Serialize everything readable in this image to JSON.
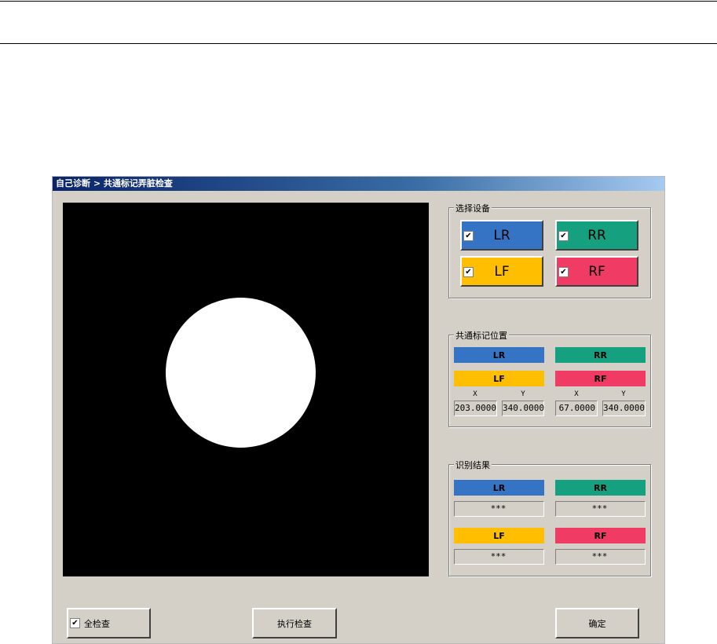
{
  "window": {
    "title": "自己诊断 > 共通标记弄脏检查"
  },
  "colors": {
    "LR": "#3574c4",
    "RR": "#15a080",
    "LF": "#ffbf00",
    "RF": "#f03c64"
  },
  "select_devices": {
    "label": "选择设备",
    "devices": [
      {
        "label": "LR",
        "checked": true
      },
      {
        "label": "RR",
        "checked": true
      },
      {
        "label": "LF",
        "checked": true
      },
      {
        "label": "RF",
        "checked": true
      }
    ]
  },
  "marker_position": {
    "label": "共通标记位置",
    "bars": [
      "LR",
      "RR",
      "LF",
      "RF"
    ],
    "x_label": "X",
    "y_label": "Y",
    "left": {
      "x": "203.0000",
      "y": "340.0000"
    },
    "right": {
      "x": "67.0000",
      "y": "340.0000"
    }
  },
  "result": {
    "label": "识别结果",
    "LR": {
      "label": "LR",
      "value": "***"
    },
    "RR": {
      "label": "RR",
      "value": "***"
    },
    "LF": {
      "label": "LF",
      "value": "***"
    },
    "RF": {
      "label": "RF",
      "value": "***"
    }
  },
  "buttons": {
    "check_all": "全检查",
    "check_all_checked": true,
    "execute": "执行检查",
    "ok": "确定"
  }
}
